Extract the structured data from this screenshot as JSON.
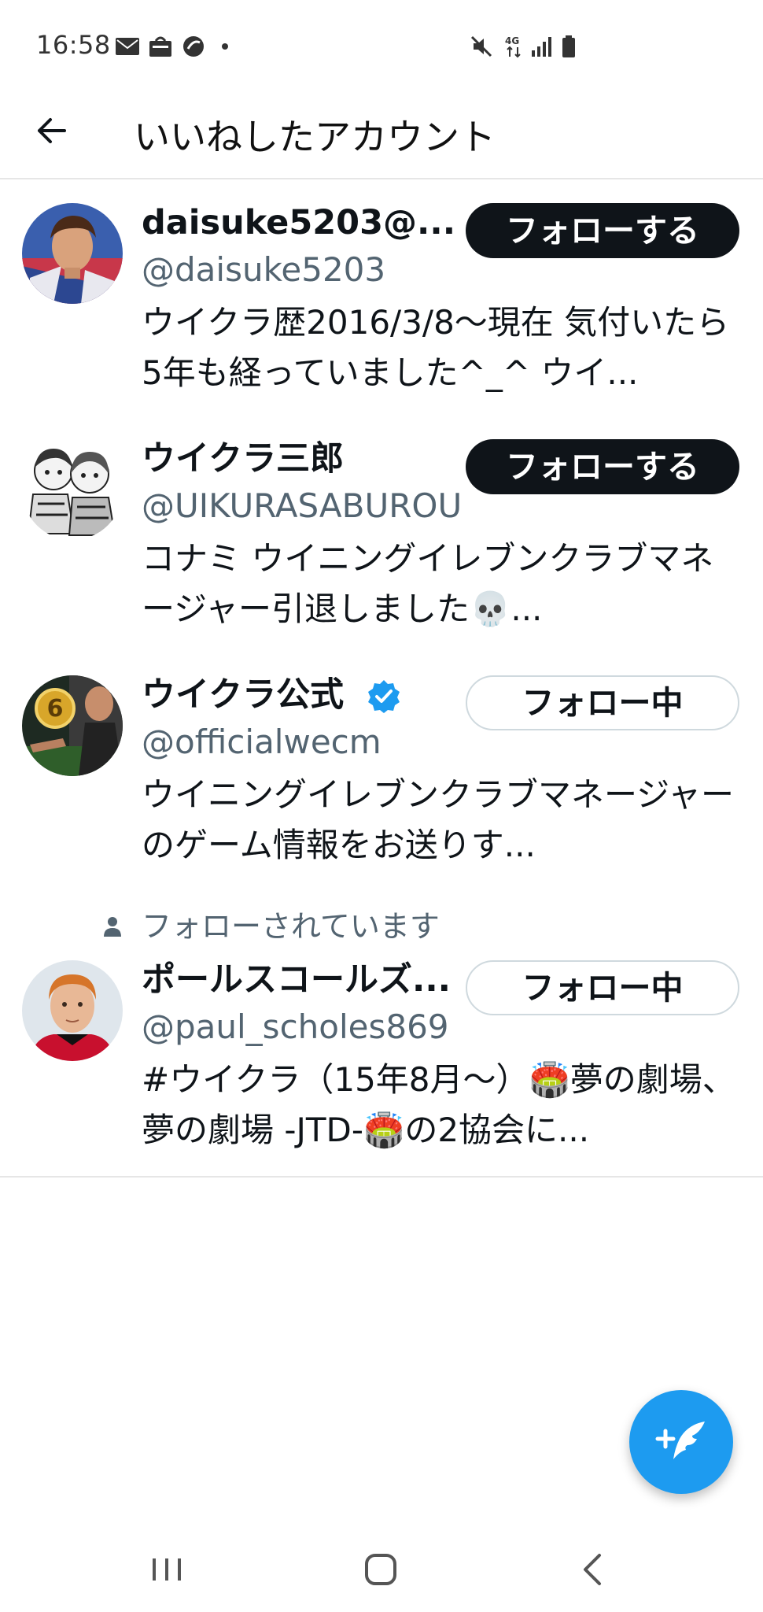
{
  "status_bar": {
    "time": "16:58",
    "icons": [
      "mail-icon",
      "bag-icon",
      "app-icon",
      "dot-icon",
      "mute-icon",
      "network-4g-icon",
      "signal-icon",
      "battery-icon"
    ]
  },
  "header": {
    "title": "いいねしたアカウント",
    "back_icon": "arrow-left-icon"
  },
  "users": [
    {
      "name": "daisuke5203@...",
      "handle": "@daisuke5203",
      "bio": "ウイクラ歴2016/3/8〜現在 気付いたら5年も経っていました^_^ ウイ...",
      "button": "フォローする",
      "following": false,
      "verified": false
    },
    {
      "name": "ウイクラ三郎",
      "handle": "@UIKURASABUROU",
      "bio": "コナミ ウイニングイレブンクラブマネージャー引退しました💀...",
      "button": "フォローする",
      "following": false,
      "verified": false
    },
    {
      "name": "ウイクラ公式",
      "handle": "@officialwecm",
      "bio": "ウイニングイレブンクラブマネージャーのゲーム情報をお送りす...",
      "button": "フォロー中",
      "following": true,
      "verified": true
    },
    {
      "follows_you": "フォローされています",
      "name": "ポールスコールズ...",
      "handle": "@paul_scholes869",
      "bio": "#ウイクラ（15年8月〜）🏟️夢の劇場、夢の劇場 -JTD-🏟️の2協会に...",
      "button": "フォロー中",
      "following": true,
      "verified": false
    }
  ],
  "colors": {
    "accent": "#1d9bf0",
    "text": "#0f1419",
    "secondary": "#536471",
    "divider": "#e6e6e6"
  },
  "fab_icon": "compose-tweet-icon",
  "nav_icons": [
    "recent-apps-icon",
    "home-icon",
    "back-icon"
  ]
}
